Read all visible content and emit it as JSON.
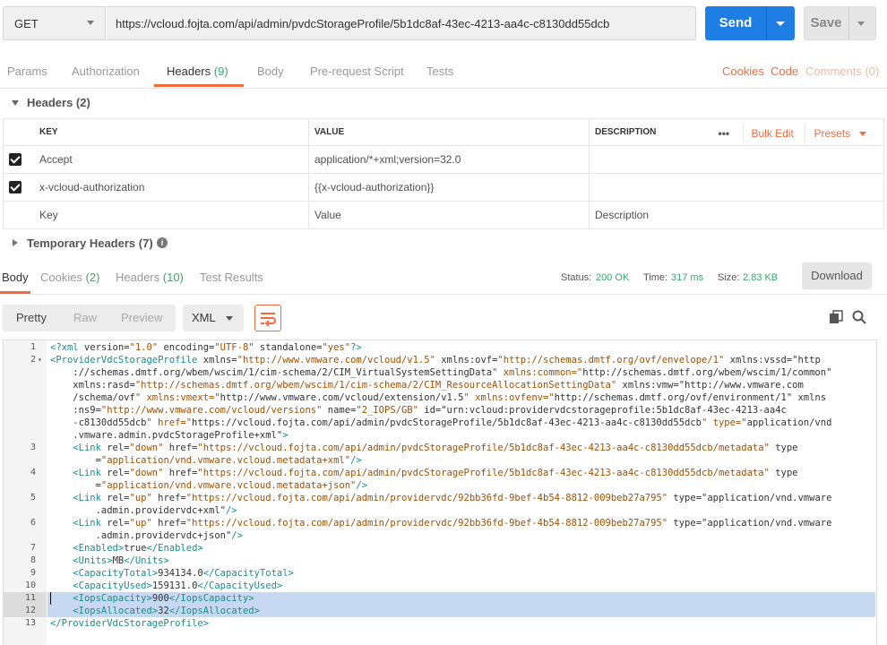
{
  "request": {
    "method": "GET",
    "url": "https://vcloud.fojta.com/api/admin/pvdcStorageProfile/5b1dc8af-43ec-4213-aa4c-c8130dd55dcb",
    "send_label": "Send",
    "save_label": "Save"
  },
  "req_tabs": {
    "params": "Params",
    "authorization": "Authorization",
    "headers": "Headers",
    "headers_count": "(9)",
    "body": "Body",
    "prerequest": "Pre-request Script",
    "tests": "Tests",
    "cookies": "Cookies",
    "code": "Code",
    "comments": "Comments (0)"
  },
  "headers_section": {
    "title": "Headers (2)",
    "col_key": "KEY",
    "col_value": "VALUE",
    "col_description": "DESCRIPTION",
    "more": "•••",
    "bulk_edit": "Bulk Edit",
    "presets": "Presets",
    "rows": [
      {
        "key": "Accept",
        "value": "application/*+xml;version=32.0"
      },
      {
        "key": "x-vcloud-authorization",
        "value": "{{x-vcloud-authorization}}"
      }
    ],
    "placeholder_key": "Key",
    "placeholder_value": "Value",
    "placeholder_description": "Description",
    "temp_headers": "Temporary Headers (7)"
  },
  "resp_tabs": {
    "body": "Body",
    "cookies": "Cookies",
    "cookies_count": "(2)",
    "headers": "Headers",
    "headers_count": "(10)",
    "test_results": "Test Results"
  },
  "status": {
    "status_label": "Status:",
    "status_value": "200 OK",
    "time_label": "Time:",
    "time_value": "317 ms",
    "size_label": "Size:",
    "size_value": "2.83 KB",
    "download": "Download"
  },
  "view": {
    "pretty": "Pretty",
    "raw": "Raw",
    "preview": "Preview",
    "format": "XML"
  },
  "icons": {
    "wrap": "wrap-lines-icon",
    "copy": "copy-icon",
    "search": "search-icon",
    "info": "info-icon"
  },
  "colors": {
    "accent": "#f26b3a",
    "send": "#1e7ee4",
    "ok": "#3aa76d",
    "selection": "#c7d8f3"
  },
  "code_lines": [
    {
      "n": "1",
      "t": "<?xml version=\"1.0\" encoding=\"UTF-8\" standalone=\"yes\"?>"
    },
    {
      "n": "2",
      "fold": true,
      "t": "<ProviderVdcStorageProfile xmlns=\"http://www.vmware.com/vcloud/v1.5\" xmlns:ovf=\"http://schemas.dmtf.org/ovf/envelope/1\" xmlns:vssd=\"http"
    },
    {
      "n": "",
      "t": "    ://schemas.dmtf.org/wbem/wscim/1/cim-schema/2/CIM_VirtualSystemSettingData\" xmlns:common=\"http://schemas.dmtf.org/wbem/wscim/1/common\""
    },
    {
      "n": "",
      "t": "    xmlns:rasd=\"http://schemas.dmtf.org/wbem/wscim/1/cim-schema/2/CIM_ResourceAllocationSettingData\" xmlns:vmw=\"http://www.vmware.com"
    },
    {
      "n": "",
      "t": "    /schema/ovf\" xmlns:vmext=\"http://www.vmware.com/vcloud/extension/v1.5\" xmlns:ovfenv=\"http://schemas.dmtf.org/ovf/environment/1\" xmlns"
    },
    {
      "n": "",
      "t": "    :ns9=\"http://www.vmware.com/vcloud/versions\" name=\"2_IOPS/GB\" id=\"urn:vcloud:providervdcstorageprofile:5b1dc8af-43ec-4213-aa4c"
    },
    {
      "n": "",
      "t": "    -c8130dd55dcb\" href=\"https://vcloud.fojta.com/api/admin/pvdcStorageProfile/5b1dc8af-43ec-4213-aa4c-c8130dd55dcb\" type=\"application/vnd"
    },
    {
      "n": "",
      "t": "    .vmware.admin.pvdcStorageProfile+xml\">"
    },
    {
      "n": "3",
      "t": "    <Link rel=\"down\" href=\"https://vcloud.fojta.com/api/admin/pvdcStorageProfile/5b1dc8af-43ec-4213-aa4c-c8130dd55dcb/metadata\" type"
    },
    {
      "n": "",
      "t": "        =\"application/vnd.vmware.vcloud.metadata+xml\"/>"
    },
    {
      "n": "4",
      "t": "    <Link rel=\"down\" href=\"https://vcloud.fojta.com/api/admin/pvdcStorageProfile/5b1dc8af-43ec-4213-aa4c-c8130dd55dcb/metadata\" type"
    },
    {
      "n": "",
      "t": "        =\"application/vnd.vmware.vcloud.metadata+json\"/>"
    },
    {
      "n": "5",
      "t": "    <Link rel=\"up\" href=\"https://vcloud.fojta.com/api/admin/providervdc/92bb36fd-9bef-4b54-8812-009beb27a795\" type=\"application/vnd.vmware"
    },
    {
      "n": "",
      "t": "        .admin.providervdc+xml\"/>"
    },
    {
      "n": "6",
      "t": "    <Link rel=\"up\" href=\"https://vcloud.fojta.com/api/admin/providervdc/92bb36fd-9bef-4b54-8812-009beb27a795\" type=\"application/vnd.vmware"
    },
    {
      "n": "",
      "t": "        .admin.providervdc+json\"/>"
    },
    {
      "n": "7",
      "t": "    <Enabled>true</Enabled>"
    },
    {
      "n": "8",
      "t": "    <Units>MB</Units>"
    },
    {
      "n": "9",
      "t": "    <CapacityTotal>934134.0</CapacityTotal>"
    },
    {
      "n": "10",
      "t": "    <CapacityUsed>159131.0</CapacityUsed>"
    },
    {
      "n": "11",
      "sel": true,
      "t": "    <IopsCapacity>900</IopsCapacity>"
    },
    {
      "n": "12",
      "sel": true,
      "t": "    <IopsAllocated>32</IopsAllocated>"
    },
    {
      "n": "13",
      "t": "</ProviderVdcStorageProfile>"
    }
  ]
}
